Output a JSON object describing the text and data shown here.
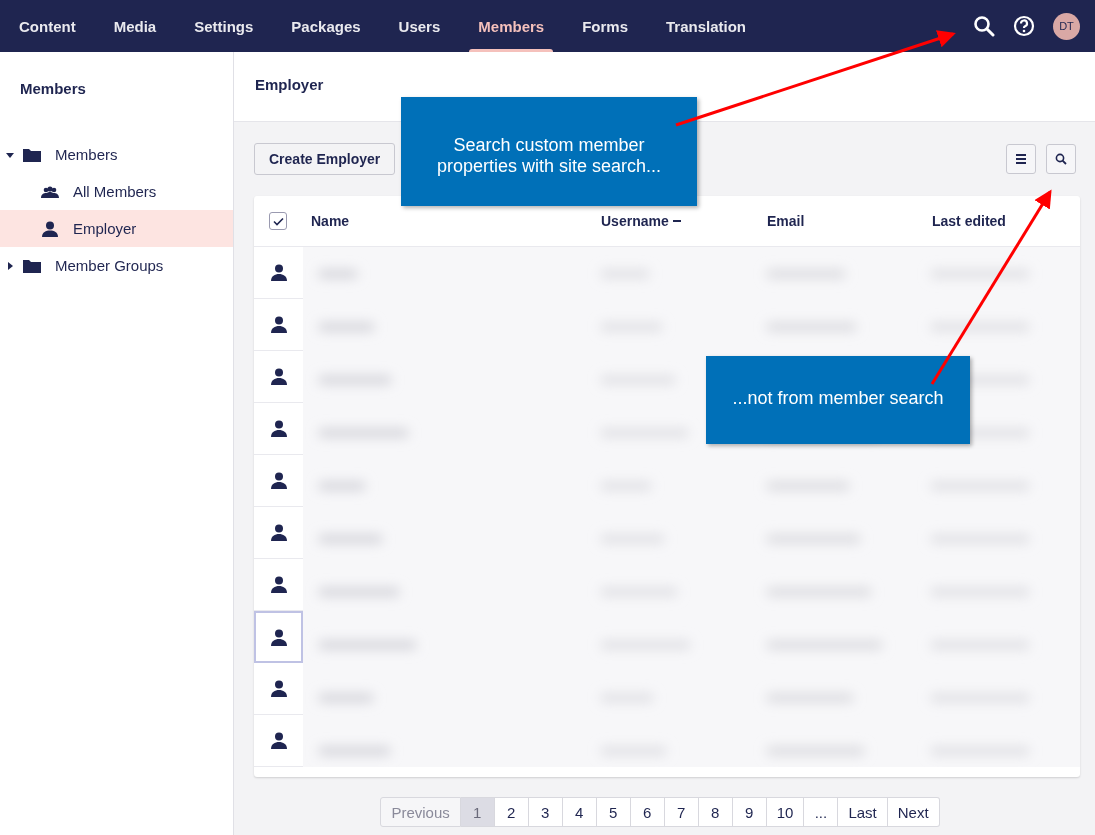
{
  "top_nav": {
    "tabs": [
      {
        "label": "Content",
        "selected": false
      },
      {
        "label": "Media",
        "selected": false
      },
      {
        "label": "Settings",
        "selected": false
      },
      {
        "label": "Packages",
        "selected": false
      },
      {
        "label": "Users",
        "selected": false
      },
      {
        "label": "Members",
        "selected": true
      },
      {
        "label": "Forms",
        "selected": false
      },
      {
        "label": "Translation",
        "selected": false
      }
    ],
    "user_initials": "DT"
  },
  "sidebar": {
    "title": "Members",
    "tree": [
      {
        "label": "Members",
        "kind": "folder",
        "expanded": true,
        "selected": false,
        "children": [
          {
            "label": "All Members",
            "kind": "group",
            "selected": false
          },
          {
            "label": "Employer",
            "kind": "person",
            "selected": true
          }
        ]
      },
      {
        "label": "Member Groups",
        "kind": "folder",
        "expanded": false,
        "selected": false
      }
    ]
  },
  "main": {
    "title": "Employer",
    "create_button": "Create Employer",
    "table": {
      "select_all_checked": true,
      "columns": [
        {
          "label": "Name",
          "sorted": false
        },
        {
          "label": "Username",
          "sorted": true
        },
        {
          "label": "Email",
          "sorted": false
        },
        {
          "label": "Last edited",
          "sorted": false
        }
      ],
      "rows": [
        {
          "focused": false
        },
        {
          "focused": false
        },
        {
          "focused": false
        },
        {
          "focused": false
        },
        {
          "focused": false
        },
        {
          "focused": false
        },
        {
          "focused": false
        },
        {
          "focused": true
        },
        {
          "focused": false
        },
        {
          "focused": false
        }
      ]
    },
    "pagination": [
      {
        "label": "Previous",
        "disabled": true,
        "selected": false
      },
      {
        "label": "1",
        "disabled": false,
        "selected": true
      },
      {
        "label": "2",
        "disabled": false,
        "selected": false
      },
      {
        "label": "3",
        "disabled": false,
        "selected": false
      },
      {
        "label": "4",
        "disabled": false,
        "selected": false
      },
      {
        "label": "5",
        "disabled": false,
        "selected": false
      },
      {
        "label": "6",
        "disabled": false,
        "selected": false
      },
      {
        "label": "7",
        "disabled": false,
        "selected": false
      },
      {
        "label": "8",
        "disabled": false,
        "selected": false
      },
      {
        "label": "9",
        "disabled": false,
        "selected": false
      },
      {
        "label": "10",
        "disabled": false,
        "selected": false
      },
      {
        "label": "...",
        "disabled": false,
        "selected": false
      },
      {
        "label": "Last",
        "disabled": false,
        "selected": false
      },
      {
        "label": "Next",
        "disabled": false,
        "selected": false
      }
    ]
  },
  "annotations": [
    {
      "text": "Search custom member properties with site search..."
    },
    {
      "text": "...not from member search"
    }
  ]
}
